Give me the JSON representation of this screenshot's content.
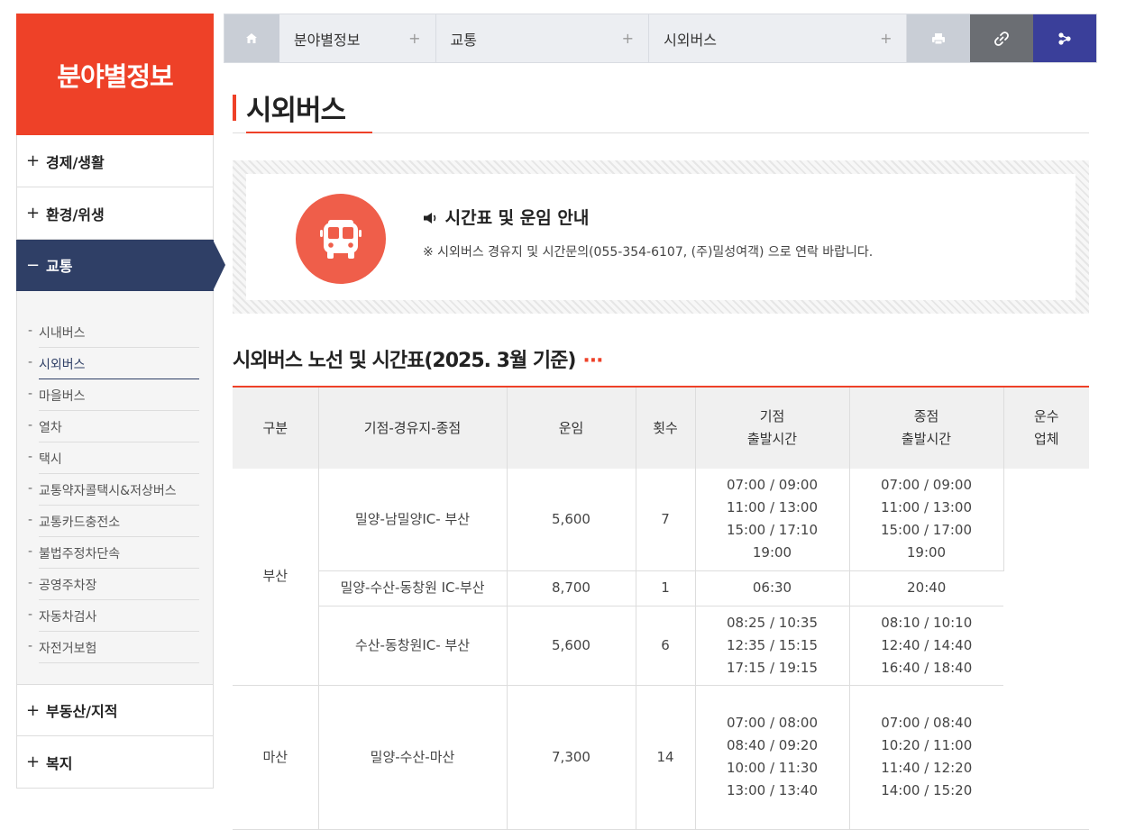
{
  "sidebar": {
    "title": "분야별정보",
    "items": [
      {
        "label": "경제/생활",
        "sign": "+"
      },
      {
        "label": "환경/위생",
        "sign": "+"
      },
      {
        "label": "교통",
        "sign": "−"
      },
      {
        "label": "부동산/지적",
        "sign": "+"
      },
      {
        "label": "복지",
        "sign": "+"
      }
    ],
    "submenu": [
      "시내버스",
      "시외버스",
      "마을버스",
      "열차",
      "택시",
      "교통약자콜택시&저상버스",
      "교통카드충전소",
      "불법주정차단속",
      "공영주차장",
      "자동차검사",
      "자전거보험"
    ]
  },
  "breadcrumb": {
    "crumbs": [
      "분야별정보",
      "교통",
      "시외버스"
    ],
    "plus": "+"
  },
  "colors": {
    "accent": "#ee4128",
    "navy": "#2f3f66",
    "share": "#3a3f9a",
    "link": "#6b6e73"
  },
  "page": {
    "title": "시외버스"
  },
  "notice": {
    "heading": "시간표 및 운임 안내",
    "icon": "speaker-icon",
    "text": "※ 시외버스 경유지 및 시간문의(055-354-6107, (주)밀성여객) 으로 연락 바랍니다."
  },
  "section": {
    "title": "시외버스 노선 및 시간표(2025. 3월 기준)",
    "dots": "···"
  },
  "table": {
    "headers": [
      "구분",
      "기점-경유지-종점",
      "운임",
      "횟수",
      "기점\n출발시간",
      "종점\n출발시간",
      "운수\n업체"
    ],
    "groups": [
      {
        "region": "부산",
        "rows": [
          {
            "route": "밀양-남밀양IC- 부산",
            "fare": "5,600",
            "count": "7",
            "depart": [
              "07:00 / 09:00",
              "11:00 / 13:00",
              "15:00 / 17:10",
              "19:00"
            ],
            "arrive": [
              "07:00 / 09:00",
              "11:00 / 13:00",
              "15:00 / 17:00",
              "19:00"
            ]
          },
          {
            "route": "밀양-수산-동창원 IC-부산",
            "fare": "8,700",
            "count": "1",
            "depart": [
              "06:30"
            ],
            "arrive": [
              "20:40"
            ]
          },
          {
            "route": "수산-동창원IC- 부산",
            "fare": "5,600",
            "count": "6",
            "depart": [
              "08:25 / 10:35",
              "12:35 / 15:15",
              "17:15 / 19:15"
            ],
            "arrive": [
              "08:10 / 10:10",
              "12:40 / 14:40",
              "16:40 / 18:40"
            ]
          }
        ]
      },
      {
        "region": "마산",
        "rows": [
          {
            "route": "밀양-수산-마산",
            "fare": "7,300",
            "count": "14",
            "depart": [
              "07:00 / 08:00",
              "08:40 / 09:20",
              "10:00 / 11:30",
              "13:00 / 13:40"
            ],
            "arrive": [
              "07:00 / 08:40",
              "10:20 / 11:00",
              "11:40 / 12:20",
              "14:00 / 15:20"
            ]
          }
        ]
      }
    ]
  }
}
